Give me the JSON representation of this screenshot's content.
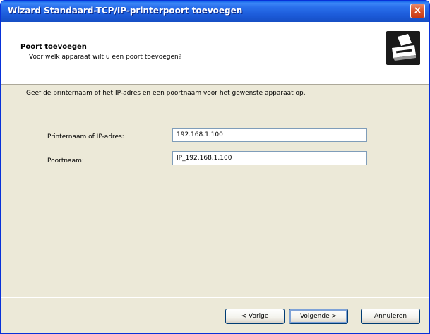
{
  "window": {
    "title": "Wizard Standaard-TCP/IP-printerpoort toevoegen",
    "close_label": "×"
  },
  "header": {
    "title": "Poort toevoegen",
    "subtitle": "Voor welk apparaat wilt u een poort toevoegen?",
    "icon": "printer-icon"
  },
  "main": {
    "instruction": "Geef de printernaam of het IP-adres en een poortnaam voor het gewenste apparaat op.",
    "fields": [
      {
        "label": "Printernaam of IP-adres:",
        "value": "192.168.1.100"
      },
      {
        "label": "Poortnaam:",
        "value": "IP_192.168.1.100"
      }
    ]
  },
  "buttons": {
    "back": "< Vorige",
    "next": "Volgende >",
    "cancel": "Annuleren"
  },
  "colors": {
    "titlebar": "#2a70ec",
    "dialog_background": "#ece9d8",
    "close_button": "#d9542b",
    "input_border": "#7f9db9"
  }
}
